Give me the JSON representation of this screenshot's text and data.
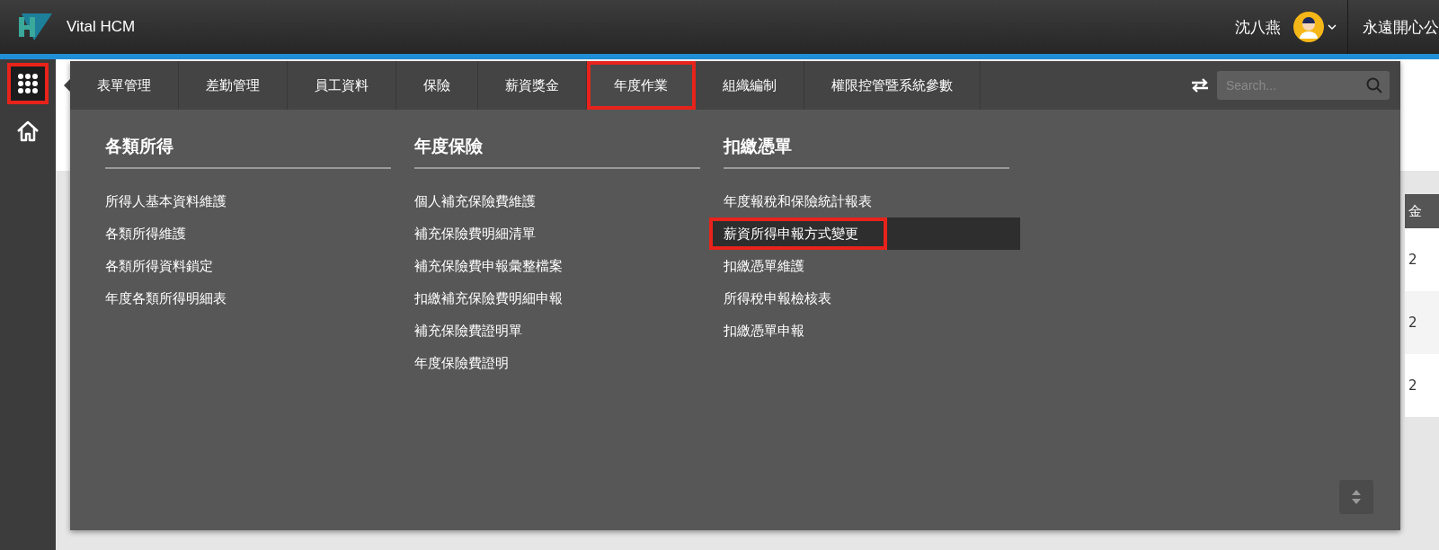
{
  "app": {
    "name": "Vital HCM"
  },
  "user": {
    "name": "沈八燕",
    "company": "永遠開心公"
  },
  "sidebar": {
    "apps_button": {
      "highlighted": true
    }
  },
  "tabs": [
    {
      "label": "表單管理",
      "selected": false
    },
    {
      "label": "差勤管理",
      "selected": false
    },
    {
      "label": "員工資料",
      "selected": false
    },
    {
      "label": "保險",
      "selected": false
    },
    {
      "label": "薪資獎金",
      "selected": false
    },
    {
      "label": "年度作業",
      "selected": true
    },
    {
      "label": "組織編制",
      "selected": false
    },
    {
      "label": "權限控管暨系統參數",
      "selected": false
    }
  ],
  "search": {
    "placeholder": "Search..."
  },
  "menu_columns": [
    {
      "title": "各類所得",
      "items": [
        {
          "label": "所得人基本資料維護",
          "selected": false
        },
        {
          "label": "各類所得維護",
          "selected": false
        },
        {
          "label": "各類所得資料鎖定",
          "selected": false
        },
        {
          "label": "年度各類所得明細表",
          "selected": false
        }
      ]
    },
    {
      "title": "年度保險",
      "items": [
        {
          "label": "個人補充保險費維護",
          "selected": false
        },
        {
          "label": "補充保險費明細清單",
          "selected": false
        },
        {
          "label": "補充保險費申報彙整檔案",
          "selected": false
        },
        {
          "label": "扣繳補充保險費明細申報",
          "selected": false
        },
        {
          "label": "補充保險費證明單",
          "selected": false
        },
        {
          "label": "年度保險費證明",
          "selected": false
        }
      ]
    },
    {
      "title": "扣繳憑單",
      "items": [
        {
          "label": "年度報稅和保險統計報表",
          "selected": false
        },
        {
          "label": "薪資所得申報方式變更",
          "selected": true
        },
        {
          "label": "扣繳憑單維護",
          "selected": false
        },
        {
          "label": "所得稅申報檢核表",
          "selected": false
        },
        {
          "label": "扣繳憑單申報",
          "selected": false
        }
      ]
    }
  ],
  "background_table": {
    "column_1": "金",
    "rows": [
      "2",
      "2",
      "2"
    ]
  }
}
